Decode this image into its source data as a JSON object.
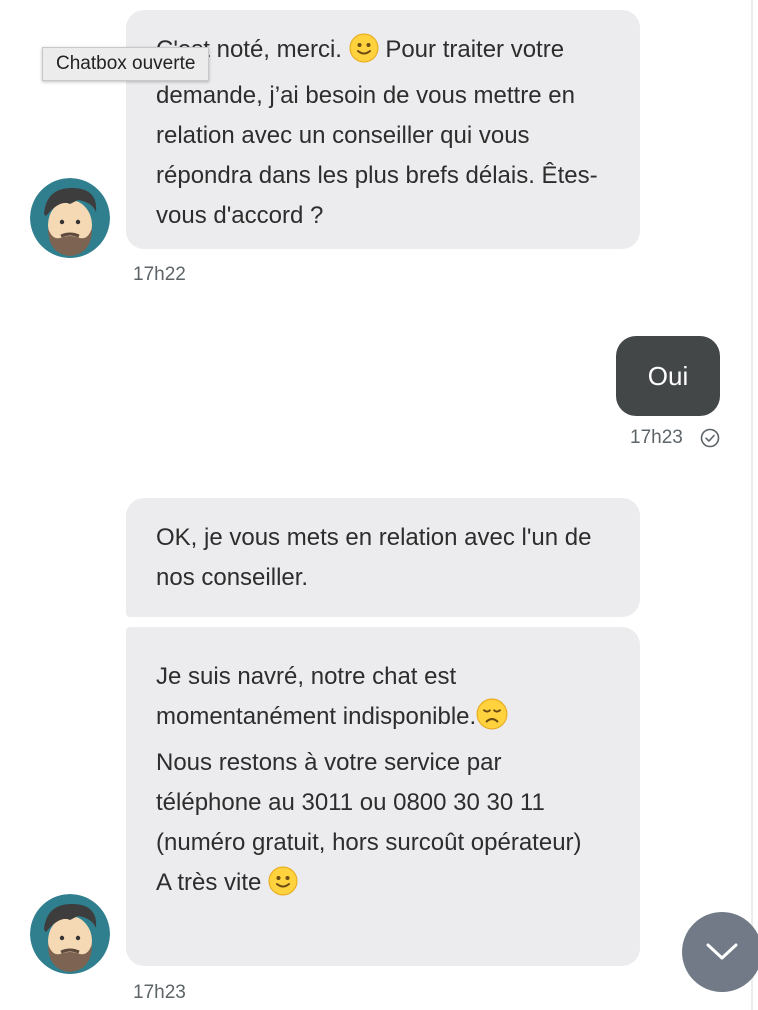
{
  "tooltip": {
    "text": "Chatbox ouverte"
  },
  "messages": [
    {
      "sender": "bot",
      "text_lines": [
        "C'est noté, merci.",
        "Pour traiter votre demande, j’ai besoin de vous mettre en relation avec un conseiller qui vous répondra dans les plus brefs délais. Êtes-vous d'accord ?"
      ],
      "emoji": "slightly-smiling-face",
      "time": "17h22"
    },
    {
      "sender": "user",
      "text": "Oui",
      "time": "17h23",
      "status": "read-check-icon"
    },
    {
      "sender": "bot",
      "text": "OK, je vous mets en relation avec l'un de nos conseiller."
    },
    {
      "sender": "bot",
      "text_lines": [
        "Je suis navré, notre chat est momentanément indisponible.",
        "Nous restons à votre service par téléphone au 3011 ou 0800 30 30 11 (numéro gratuit, hors surcoût opérateur)",
        "A très vite"
      ],
      "emojis": [
        "disappointed-face",
        "slightly-smiling-face"
      ],
      "time": "17h23"
    }
  ],
  "scroll_button": {
    "icon": "chevron-down-icon"
  },
  "colors": {
    "bot_bubble": "#ececee",
    "user_bubble": "#434748",
    "scroll_button": "#717a86",
    "avatar_bg": "#2f7f8f"
  }
}
